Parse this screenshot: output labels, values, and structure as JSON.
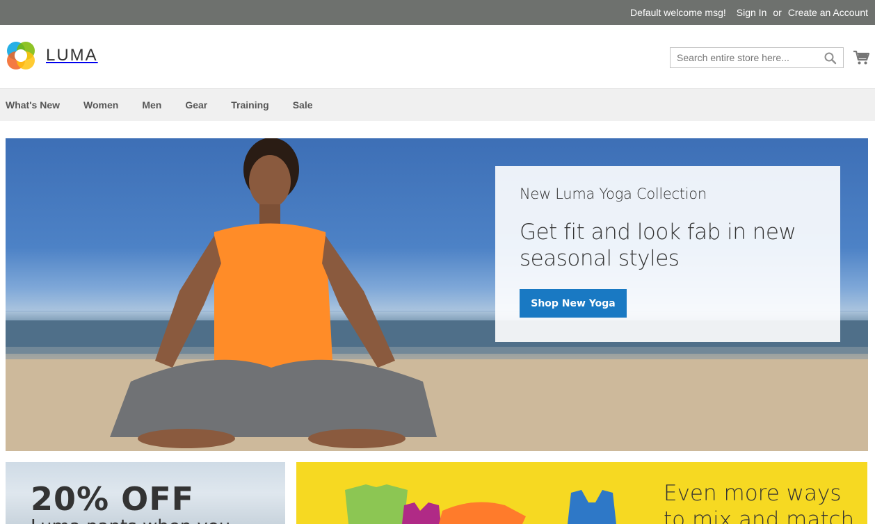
{
  "topbar": {
    "welcome": "Default welcome msg!",
    "sign_in": "Sign In",
    "or": "or",
    "create_account": "Create an Account"
  },
  "header": {
    "logo_text": "LUMA",
    "search_placeholder": "Search entire store here...",
    "search_icon": "search-icon",
    "cart_icon": "shopping-cart-icon"
  },
  "nav": {
    "items": [
      "What's New",
      "Women",
      "Men",
      "Gear",
      "Training",
      "Sale"
    ]
  },
  "hero": {
    "eyebrow": "New Luma Yoga Collection",
    "headline": "Get fit and look fab in new seasonal styles",
    "button": "Shop New Yoga",
    "button_color": "#1979c3"
  },
  "tiles": {
    "left_title": "20% OFF",
    "left_sub": "Luma pants when you",
    "right_headline": "Even more ways to mix and match",
    "right_bg": "#f6d922"
  },
  "colors": {
    "topbar": "#6e716e",
    "nav_bg": "#f0f0f0"
  }
}
